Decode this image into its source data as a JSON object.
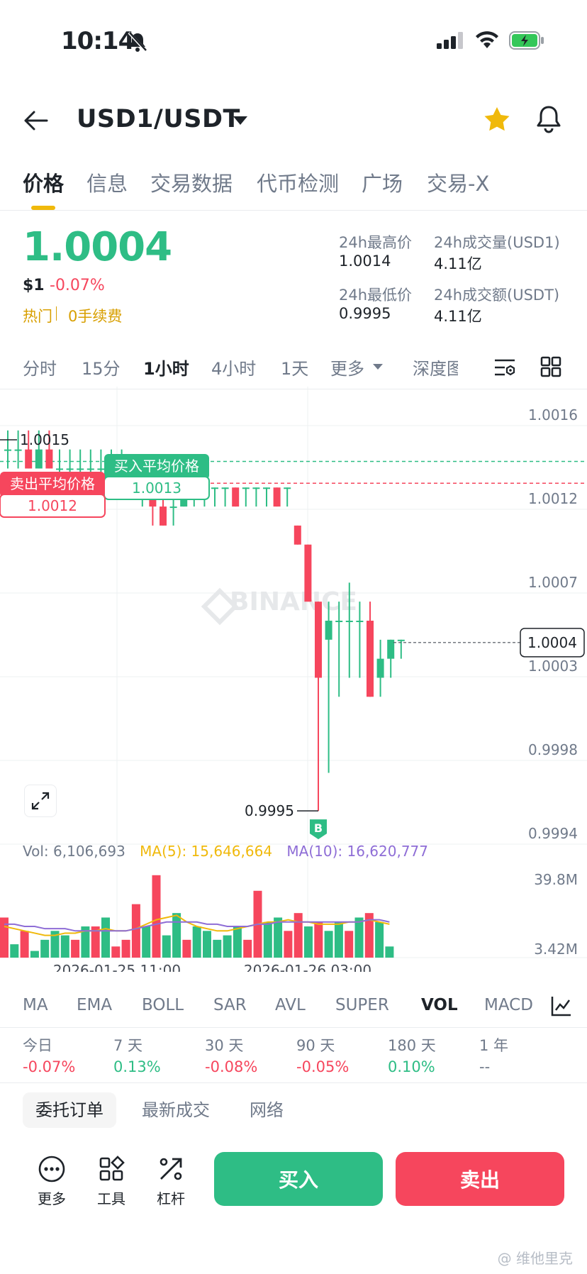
{
  "status": {
    "time": "10:14"
  },
  "header": {
    "pair": "USD1/USDT"
  },
  "tabs": [
    "价格",
    "信息",
    "交易数据",
    "代币检测",
    "广场",
    "交易-X"
  ],
  "price": {
    "last": "1.0004",
    "usd": "$1",
    "change": "-0.07%",
    "tags": [
      "热门",
      "0手续费"
    ],
    "high_label": "24h最高价",
    "high": "1.0014",
    "low_label": "24h最低价",
    "low": "0.9995",
    "vol_label": "24h成交量(USD1)",
    "vol": "4.11亿",
    "amt_label": "24h成交额(USDT)",
    "amt": "4.11亿"
  },
  "intervals": [
    "分时",
    "15分",
    "1小时",
    "4小时",
    "1天",
    "更多",
    "深度图"
  ],
  "chart_data": {
    "type": "candlestick",
    "interval": "1小时",
    "y_ticks": [
      "1.0016",
      "1.0012",
      "1.0007",
      "1.0003",
      "0.9998",
      "0.9994"
    ],
    "ylim": [
      0.9994,
      1.0016
    ],
    "x_ticks": [
      "2026-01-25 11:00",
      "2026-01-26 03:00"
    ],
    "last_price_label": "1.0004",
    "max_label": "1.0015",
    "min_label": "0.9995",
    "buy_avg": {
      "label": "买入平均价格",
      "value": "1.0013",
      "price": 1.0013
    },
    "sell_avg": {
      "label": "卖出平均价格",
      "value": "1.0012",
      "price": 1.0012
    },
    "marker": "B",
    "watermark": "BINANCE",
    "colors": {
      "up": "#2ebd85",
      "down": "#f6465d",
      "ma5": "#f0b90b",
      "ma10": "#8e6dd6"
    },
    "candles": [
      [
        1.0014,
        1.0015,
        1.0013,
        1.0014
      ],
      [
        1.0014,
        1.0015,
        1.0013,
        1.0014
      ],
      [
        1.0014,
        1.0015,
        1.0013,
        1.0013
      ],
      [
        1.0013,
        1.0015,
        1.0013,
        1.0014
      ],
      [
        1.0014,
        1.0015,
        1.0013,
        1.0013
      ],
      [
        1.0013,
        1.0014,
        1.0012,
        1.0013
      ],
      [
        1.0013,
        1.0014,
        1.0012,
        1.0013
      ],
      [
        1.0013,
        1.0014,
        1.0012,
        1.0013
      ],
      [
        1.0013,
        1.0014,
        1.0012,
        1.0013
      ],
      [
        1.0013,
        1.0014,
        1.0012,
        1.0013
      ],
      [
        1.0013,
        1.0014,
        1.0012,
        1.0013
      ],
      [
        1.0013,
        1.0014,
        1.0012,
        1.0013
      ],
      [
        1.0013,
        1.0013,
        1.0012,
        1.0012
      ],
      [
        1.0012,
        1.0013,
        1.0011,
        1.0012
      ],
      [
        1.0012,
        1.0012,
        1.001,
        1.0011
      ],
      [
        1.0011,
        1.0012,
        1.001,
        1.001
      ],
      [
        1.0011,
        1.0012,
        1.001,
        1.0011
      ],
      [
        1.0011,
        1.0012,
        1.0011,
        1.0012
      ],
      [
        1.0012,
        1.0012,
        1.0011,
        1.0012
      ],
      [
        1.0012,
        1.0012,
        1.0011,
        1.0012
      ],
      [
        1.0012,
        1.0012,
        1.0011,
        1.0012
      ],
      [
        1.0012,
        1.0012,
        1.0011,
        1.0012
      ],
      [
        1.0012,
        1.0012,
        1.0011,
        1.0011
      ],
      [
        1.0012,
        1.0012,
        1.0011,
        1.0012
      ],
      [
        1.0012,
        1.0012,
        1.0011,
        1.0012
      ],
      [
        1.0012,
        1.0012,
        1.0011,
        1.0012
      ],
      [
        1.0012,
        1.0012,
        1.0011,
        1.0011
      ],
      [
        1.0012,
        1.0012,
        1.0011,
        1.0012
      ],
      [
        1.001,
        1.001,
        1.0009,
        1.0009
      ],
      [
        1.0009,
        1.0009,
        1.0006,
        1.0006
      ],
      [
        1.0006,
        1.0006,
        0.9995,
        1.0002
      ],
      [
        1.0004,
        1.0006,
        0.9997,
        1.0005
      ],
      [
        1.0005,
        1.0006,
        1.0001,
        1.0005
      ],
      [
        1.0005,
        1.0007,
        1.0002,
        1.0005
      ],
      [
        1.0005,
        1.0006,
        1.0002,
        1.0005
      ],
      [
        1.0005,
        1.0006,
        1.0001,
        1.0001
      ],
      [
        1.0002,
        1.0004,
        1.0001,
        1.0003
      ],
      [
        1.0003,
        1.0004,
        1.0002,
        1.0004
      ],
      [
        1.0004,
        1.0004,
        1.0003,
        1.0004
      ]
    ],
    "volume": {
      "vol_label": "Vol: 6,106,693",
      "ma5_label": "MA(5): 15,646,664",
      "ma10_label": "MA(10): 16,620,777",
      "y_ticks": [
        "39.8M",
        "3.42M"
      ],
      "ylim": [
        0,
        39.8
      ],
      "bars": [
        18,
        6,
        12,
        3,
        8,
        12,
        10,
        8,
        14,
        14,
        18,
        5,
        8,
        24,
        14,
        37,
        10,
        20,
        8,
        14,
        12,
        8,
        10,
        14,
        8,
        30,
        16,
        18,
        12,
        20,
        14,
        16,
        12,
        16,
        12,
        18,
        20,
        16,
        5
      ],
      "bar_dir": [
        "down",
        "up",
        "down",
        "up",
        "up",
        "up",
        "up",
        "down",
        "up",
        "down",
        "up",
        "down",
        "down",
        "down",
        "up",
        "down",
        "up",
        "up",
        "down",
        "up",
        "up",
        "up",
        "up",
        "up",
        "down",
        "down",
        "up",
        "up",
        "down",
        "down",
        "up",
        "down",
        "up",
        "up",
        "down",
        "up",
        "down",
        "up",
        "up"
      ],
      "ma5": [
        14,
        13,
        12,
        11,
        10,
        10,
        11,
        11,
        12,
        12,
        13,
        12,
        12,
        13,
        15,
        17,
        18,
        19,
        16,
        14,
        13,
        12,
        12,
        13,
        14,
        15,
        16,
        16,
        17,
        16,
        16,
        15,
        15,
        15,
        16,
        16,
        17,
        16,
        15
      ],
      "ma10": [
        15,
        15,
        14,
        14,
        13,
        13,
        13,
        12,
        12,
        12,
        12,
        12,
        12,
        13,
        14,
        15,
        16,
        16,
        16,
        16,
        15,
        15,
        14,
        14,
        14,
        15,
        15,
        16,
        16,
        16,
        16,
        16,
        16,
        16,
        16,
        16,
        17,
        17,
        16
      ]
    }
  },
  "indicators": [
    "MA",
    "EMA",
    "BOLL",
    "SAR",
    "AVL",
    "SUPER",
    "VOL",
    "MACD"
  ],
  "performance": [
    {
      "label": "今日",
      "value": "-0.07%",
      "dir": "down"
    },
    {
      "label": "7 天",
      "value": "0.13%",
      "dir": "up"
    },
    {
      "label": "30 天",
      "value": "-0.08%",
      "dir": "down"
    },
    {
      "label": "90 天",
      "value": "-0.05%",
      "dir": "down"
    },
    {
      "label": "180 天",
      "value": "0.10%",
      "dir": "up"
    },
    {
      "label": "1 年",
      "value": "--",
      "dir": "flat"
    }
  ],
  "bottom_tabs": [
    "委托订单",
    "最新成交",
    "网络"
  ],
  "toolbar": {
    "more": "更多",
    "tools": "工具",
    "leverage": "杠杆",
    "buy": "买入",
    "sell": "卖出"
  },
  "watermark_corner": "@ 维他里克"
}
